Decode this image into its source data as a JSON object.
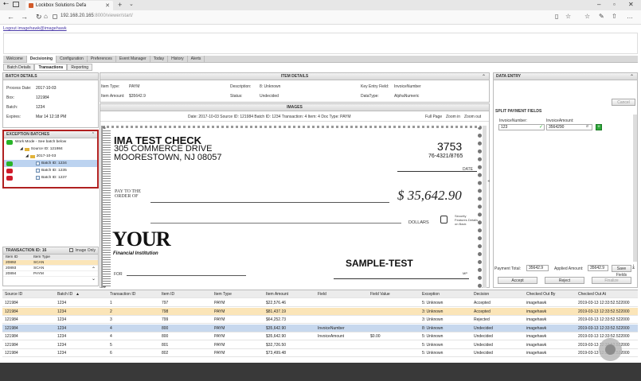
{
  "browser": {
    "tab_title": "Lockbox Solutions Defa",
    "url_host": "192.168.20.165",
    "url_rest": ":8000/viewer/start/"
  },
  "logout_link": "Logout imagehawk@imagehawk",
  "menu": [
    "Welcome",
    "Decisioning",
    "Configuration",
    "Preferences",
    "Event Manager",
    "Today",
    "History",
    "Alerts"
  ],
  "submenu": [
    "Batch Details",
    "Transactions",
    "Reporting"
  ],
  "batch_details": {
    "title": "BATCH DETAILS",
    "rows": [
      {
        "label": "Process Date:",
        "value": "2017-10-03"
      },
      {
        "label": "Box:",
        "value": "121984"
      },
      {
        "label": "Batch:",
        "value": "1234"
      },
      {
        "label": "Expires:",
        "value": "Mar 14 12:18 PM"
      }
    ]
  },
  "exception_batches": {
    "title": "EXCEPTION BATCHES",
    "work_mode": "Work Mode - See batch below",
    "source": "Source ID: 121984",
    "date": "2017-10-03",
    "batches": [
      {
        "label": "Batch ID: 1234",
        "status": "green"
      },
      {
        "label": "Batch ID: 1235",
        "status": "red"
      },
      {
        "label": "Batch ID: 1237",
        "status": "red"
      }
    ]
  },
  "transaction_panel": {
    "title": "TRANSACTION ID: 16",
    "image_only": "Image Only",
    "col_item": "Item ID",
    "col_type": "Item Type",
    "rows": [
      {
        "id": "20892",
        "type": "SCAN"
      },
      {
        "id": "20893",
        "type": "SCAN"
      },
      {
        "id": "20894",
        "type": "PAYM"
      }
    ]
  },
  "item_details": {
    "title": "ITEM DETAILS",
    "item_type_label": "Item Type:",
    "item_type": "PAYM",
    "item_amount_label": "Item Amount:",
    "item_amount": "$35642.9",
    "description_label": "Description:",
    "description": "8: Unknown",
    "status_label": "Status:",
    "status": "Undecided",
    "key_entry_label": "Key Entry Field:",
    "key_entry": "InvoiceNumber",
    "datatype_label": "DataType:",
    "datatype": "AlphaNumeric"
  },
  "images": {
    "title": "IMAGES",
    "info": "Date: 2017-10-03 Source ID: 121984 Batch ID: 1234 Transaction: 4 Item: 4 Doc Type: PAYM",
    "full_page": "Full Page",
    "zoom_in": "Zoom in",
    "zoom_out": "Zoom out"
  },
  "check": {
    "name": "IMA TEST CHECK",
    "address1": "305 COMMERCE DRIVE",
    "address2": "MOORESTOWN, NJ  08057",
    "number": "3753",
    "routing": "76-4321/8765",
    "date_label": "DATE",
    "pay_to_1": "PAY TO THE",
    "pay_to_2": "ORDER OF",
    "amount": "$ 35,642.90",
    "dollars": "DOLLARS",
    "lock_text": "Security Features Details on Back",
    "bank_1": "YOUR",
    "bank_2": "Financial Institution",
    "sample": "SAMPLE-TEST",
    "for_label": "FOR",
    "mp": "MP"
  },
  "data_entry": {
    "title": "DATA ENTRY",
    "cancel": "Cancel",
    "split_title": "SPLIT PAYMENT FIELDS",
    "invoice_number_label": "InvoiceNumber:",
    "invoice_amount_label": "InvoiceAmount:",
    "invoice_number_value": "123",
    "invoice_amount_value": "3564290",
    "payment_total_label": "Payment Total:",
    "payment_total": "35642.9",
    "applied_amount_label": "Applied Amount:",
    "applied_amount": "35642.9",
    "save_fields": "Save Fields",
    "accept": "Accept",
    "reject": "Reject",
    "finalize": "Finalize"
  },
  "grid": {
    "headers": [
      "Source ID",
      "Batch ID",
      "Transaction ID",
      "Item ID",
      "Item Type",
      "Item Amount",
      "Field",
      "Field Value",
      "Exception",
      "Decision",
      "Checked Out By",
      "Checked Out At"
    ],
    "sort_marker": "▲",
    "rows": [
      [
        "121984",
        "1234",
        "1",
        "797",
        "PAYM",
        "$22,576.46",
        "",
        "",
        "5: Unknown",
        "Accepted",
        "imagehawk",
        "2019-03-13 12:33:52.522000"
      ],
      [
        "121984",
        "1234",
        "2",
        "798",
        "PAYM",
        "$81,437.19",
        "",
        "",
        "3: Unknown",
        "Accepted",
        "imagehawk",
        "2019-03-13 12:33:52.522000"
      ],
      [
        "121984",
        "1234",
        "3",
        "799",
        "PAYM",
        "$64,252.73",
        "",
        "",
        "3: Unknown",
        "Rejected",
        "imagehawk",
        "2019-03-13 12:33:52.522000"
      ],
      [
        "121984",
        "1234",
        "4",
        "800",
        "PAYM",
        "$35,642.90",
        "InvoiceNumber",
        "",
        "8: Unknown",
        "Undecided",
        "imagehawk",
        "2019-03-13 12:33:52.522000"
      ],
      [
        "121984",
        "1234",
        "4",
        "800",
        "PAYM",
        "$35,642.90",
        "InvoiceAmount",
        "$0.00",
        "5: Unknown",
        "Undecided",
        "imagehawk",
        "2019-03-13 12:33:52.522000"
      ],
      [
        "121984",
        "1234",
        "5",
        "801",
        "PAYM",
        "$32,726.50",
        "",
        "",
        "5: Unknown",
        "Undecided",
        "imagehawk",
        "2019-03-13 12:33:52.522000"
      ],
      [
        "121984",
        "1234",
        "6",
        "802",
        "PAYM",
        "$73,499.48",
        "",
        "",
        "5: Unknown",
        "Undecided",
        "imagehawk",
        "2019-03-13 12:33:52.522000"
      ]
    ]
  },
  "colors": {
    "accent_red": "#b02020",
    "status_green": "#28b428",
    "status_red": "#d01a2a",
    "row_orange": "#fbe5b8",
    "row_blue": "#c7d8ee"
  }
}
